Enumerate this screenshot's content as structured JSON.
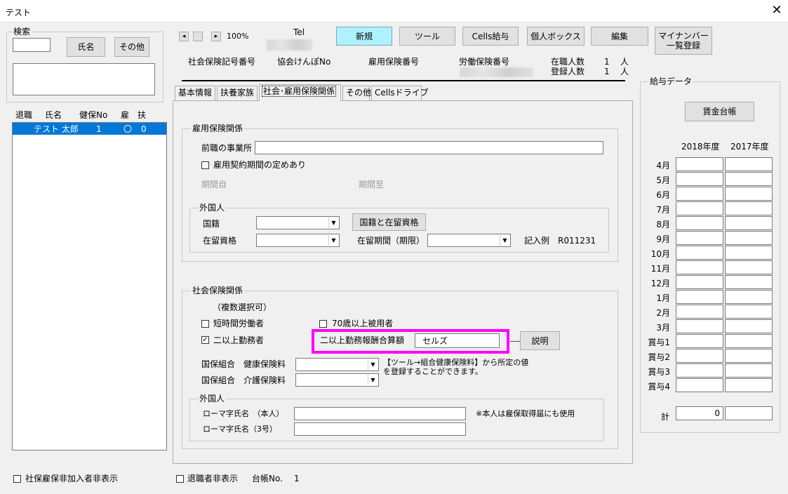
{
  "window": {
    "title": "テスト",
    "close": "✕"
  },
  "search": {
    "legend": "検索",
    "name_btn": "氏名",
    "other_btn": "その他"
  },
  "list": {
    "headers": [
      "退職",
      "氏名",
      "健保No",
      "雇",
      "扶"
    ],
    "rows": [
      {
        "name": "テスト 太郎",
        "no": "1",
        "ko": "〇",
        "fu": "0"
      }
    ]
  },
  "hide_uninsured": "社保雇保非加入者非表示",
  "nav": {
    "prev": "◂",
    "next": "▸",
    "zoom": "100%"
  },
  "header": {
    "tel": "Tel",
    "btn_new": "新規",
    "btn_tool": "ツール",
    "btn_cells": "Cells給与",
    "btn_box": "個人ボックス",
    "btn_edit": "編集",
    "btn_mynumber": "マイナンバー\n一覧登録",
    "lbl_shakai": "社会保険記号番号",
    "lbl_kyokai": "協会けんぽNo",
    "lbl_koyo": "雇用保険番号",
    "lbl_rodo": "労働保険番号",
    "lbl_zaishoku": "在職人数",
    "zaishoku_count": "1",
    "lbl_toroku": "登録人数",
    "toroku_count": "1",
    "unit": "人"
  },
  "tabs": [
    "基本情報",
    "扶養家族",
    "社会･雇用保険関係",
    "その他",
    "Cellsドライブ"
  ],
  "koyo": {
    "legend": "雇用保険関係",
    "prev_office": "前職の事業所",
    "contract_period": "雇用契約期間の定めあり",
    "period_from": "期間自",
    "period_to": "期間至",
    "foreign_legend": "外国人",
    "nationality": "国籍",
    "status": "在留資格",
    "nat_btn": "国籍と在留資格",
    "period_limit": "在留期間（期限）",
    "example": "記入例　R011231"
  },
  "shakai": {
    "legend": "社会保険関係",
    "multi": "（複数選択可）",
    "short_time": "短時間労働者",
    "over70": "70歳以上被用者",
    "multi_work": "二以上勤務者",
    "multi_work_calc": "二以上勤務報酬合算額",
    "calc_value": "セルズ",
    "explain_btn": "説明",
    "kokuho_kenko": "国保組合　健康保険料",
    "kokuho_kaigo": "国保組合　介護保険料",
    "note": "【ツール→組合健康保険料】から所定の値\nを登録することができます。",
    "foreign_legend": "外国人",
    "roman_self": "ローマ字氏名　（本人）",
    "roman_self_note": "※本人は雇保取得届にも使用",
    "roman_3": "ローマ字氏名（3号）"
  },
  "kyuyo": {
    "legend": "給与データ",
    "ledger_btn": "賃金台帳",
    "year1": "2018年度",
    "year2": "2017年度",
    "months": [
      "4月",
      "5月",
      "6月",
      "7月",
      "8月",
      "9月",
      "10月",
      "11月",
      "12月",
      "1月",
      "2月",
      "3月",
      "賞与1",
      "賞与2",
      "賞与3",
      "賞与4"
    ],
    "total_label": "計",
    "total_value": "0"
  },
  "footer": {
    "hide_retired": "退職者非表示",
    "ledger_no_label": "台帳No.",
    "ledger_no": "1"
  },
  "colors": {
    "highlight_border": "#ff00ff",
    "selected_row": "#0078d7",
    "new_btn": "#aef1ff"
  }
}
